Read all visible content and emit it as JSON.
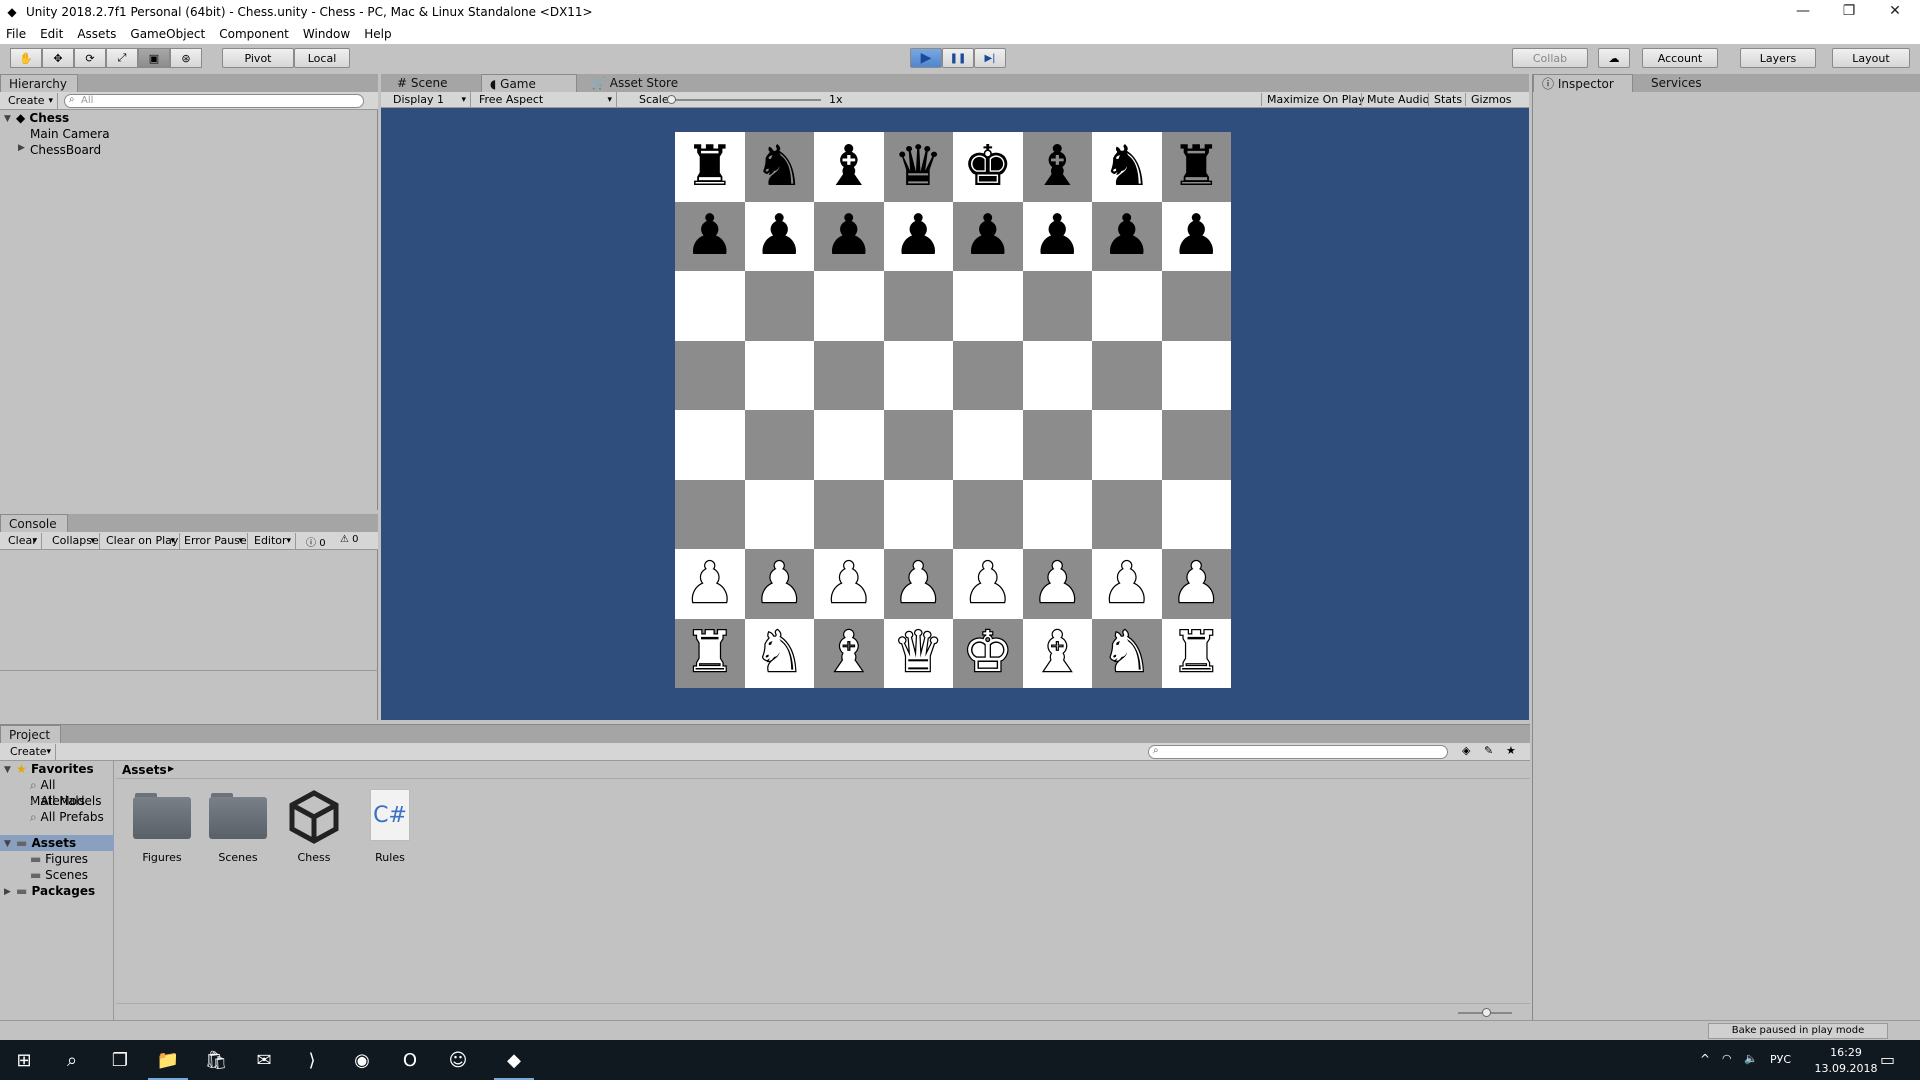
{
  "window": {
    "title": "Unity 2018.2.7f1 Personal (64bit) - Chess.unity - Chess - PC, Mac & Linux Standalone <DX11>",
    "minimize": "—",
    "restore": "❐",
    "close": "✕"
  },
  "menu": [
    "File",
    "Edit",
    "Assets",
    "GameObject",
    "Component",
    "Window",
    "Help"
  ],
  "toolbar": {
    "pivot": "Pivot",
    "local": "Local",
    "collab": "Collab",
    "account": "Account",
    "layers": "Layers",
    "layout": "Layout",
    "tools": [
      "hand-tool-icon",
      "move-tool-icon",
      "rotate-tool-icon",
      "scale-tool-icon",
      "rect-tool-icon",
      "transform-tool-icon"
    ],
    "tool_glyphs": [
      "✋",
      "✥",
      "⟳",
      "⤢",
      "▣",
      "⊛"
    ],
    "play_glyph": "▶",
    "pause_glyph": "❚❚",
    "step_glyph": "▶|",
    "cloud_glyph": "☁"
  },
  "hierarchy": {
    "tab": "Hierarchy",
    "create": "Create",
    "search_placeholder": "All",
    "scene": "Chess",
    "items": [
      "Main Camera",
      "ChessBoard"
    ]
  },
  "console": {
    "tab": "Console",
    "buttons": [
      "Clear",
      "Collapse",
      "Clear on Play",
      "Error Pause",
      "Editor"
    ],
    "info_count": "0",
    "warn_count": "0"
  },
  "center_tabs": [
    "Scene",
    "Game",
    "Asset Store"
  ],
  "game_bar": {
    "display": "Display 1",
    "aspect": "Free Aspect",
    "scale_label": "Scale",
    "scale_value": "1x",
    "scale_level": 0.0,
    "maximize": "Maximize On Play",
    "mute": "Mute Audio",
    "stats": "Stats",
    "gizmos": "Gizmos"
  },
  "board": {
    "rows": [
      [
        "♜",
        "♞",
        "♝",
        "♛",
        "♚",
        "♝",
        "♞",
        "♜"
      ],
      [
        "♟",
        "♟",
        "♟",
        "♟",
        "♟",
        "♟",
        "♟",
        "♟"
      ],
      [
        "",
        "",
        "",
        "",
        "",
        "",
        "",
        ""
      ],
      [
        "",
        "",
        "",
        "",
        "",
        "",
        "",
        ""
      ],
      [
        "",
        "",
        "",
        "",
        "",
        "",
        "",
        ""
      ],
      [
        "",
        "",
        "",
        "",
        "",
        "",
        "",
        ""
      ],
      [
        "♙",
        "♙",
        "♙",
        "♙",
        "♙",
        "♙",
        "♙",
        "♙"
      ],
      [
        "♖",
        "♘",
        "♗",
        "♕",
        "♔",
        "♗",
        "♘",
        "♖"
      ]
    ],
    "light_color": "#ffffff",
    "dark_color": "#8c8c8c"
  },
  "right_tabs": [
    "Inspector",
    "Services"
  ],
  "project": {
    "tab": "Project",
    "create": "Create",
    "favorites_label": "Favorites",
    "favorites": [
      "All Materials",
      "All Models",
      "All Prefabs"
    ],
    "assets_label": "Assets",
    "asset_folders": [
      "Figures",
      "Scenes"
    ],
    "packages_label": "Packages",
    "breadcrumb": "Assets",
    "assets": [
      {
        "name": "Figures",
        "icon": "folder-icon"
      },
      {
        "name": "Scenes",
        "icon": "folder-icon"
      },
      {
        "name": "Chess",
        "icon": "unity-scene-icon"
      },
      {
        "name": "Rules",
        "icon": "csharp-script-icon",
        "glyph": "C#"
      }
    ]
  },
  "status": {
    "bake": "Bake paused in play mode"
  },
  "taskbar": {
    "lang": "РУС",
    "time": "16:29",
    "date": "13.09.2018",
    "tray_up": "^",
    "icons": [
      {
        "name": "windows-start-icon",
        "glyph": "⊞"
      },
      {
        "name": "search-icon",
        "glyph": "⌕"
      },
      {
        "name": "task-view-icon",
        "glyph": "❐"
      },
      {
        "name": "file-explorer-icon",
        "glyph": "📁"
      },
      {
        "name": "store-icon",
        "glyph": "🛍"
      },
      {
        "name": "mail-icon",
        "glyph": "✉"
      },
      {
        "name": "visual-studio-icon",
        "glyph": "⟩"
      },
      {
        "name": "steam-icon",
        "glyph": "◉"
      },
      {
        "name": "opera-icon",
        "glyph": "O"
      },
      {
        "name": "discord-icon",
        "glyph": "☺"
      },
      {
        "name": "unity-icon",
        "glyph": "◆"
      }
    ]
  }
}
